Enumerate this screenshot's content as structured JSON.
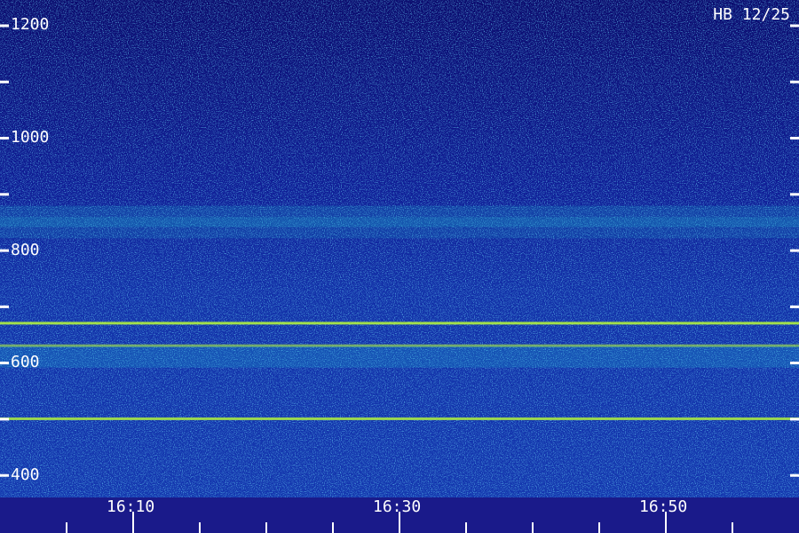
{
  "corner_label": "HB 12/25",
  "chart_data": {
    "type": "heatmap",
    "title": "",
    "xlabel": "",
    "ylabel": "",
    "y_range": [
      360,
      1245
    ],
    "y_ticks": [
      400,
      600,
      800,
      1000,
      1200
    ],
    "y_tick_labels": [
      "400",
      "600",
      "800",
      "1000",
      "1200"
    ],
    "x_tick_labels": [
      "16:10",
      "16:30",
      "16:50"
    ],
    "color_scale": [
      "#0a0a6a",
      "#1a30c8",
      "#1e78e8",
      "#20c8d8",
      "#40e890",
      "#b0f040"
    ],
    "series": [
      {
        "y": 670,
        "strength": 0.9
      },
      {
        "y": 630,
        "strength": 0.6
      },
      {
        "y": 610,
        "strength": 0.35
      },
      {
        "y": 500,
        "strength": 0.85
      },
      {
        "y": 860,
        "strength": 0.3
      },
      {
        "y": 840,
        "strength": 0.25
      }
    ]
  }
}
